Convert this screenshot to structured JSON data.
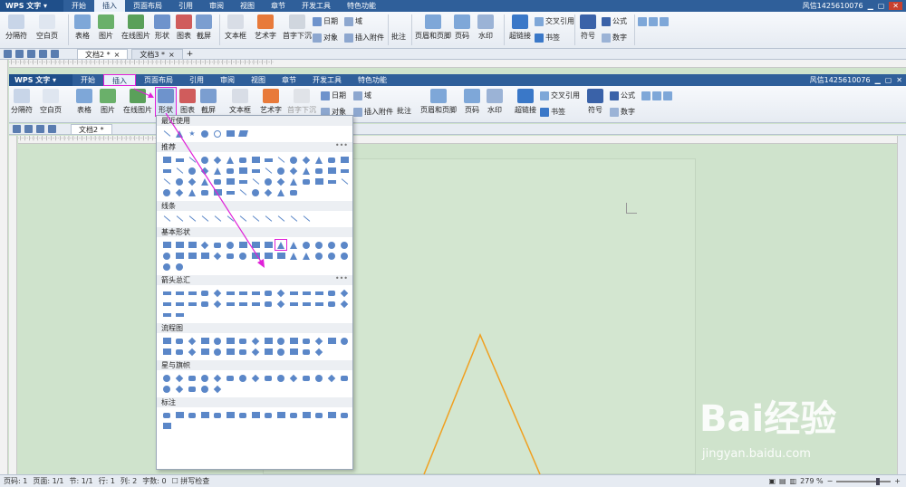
{
  "outer": {
    "app_title": "WPS 文字",
    "menus": [
      "开始",
      "插入",
      "页面布局",
      "引用",
      "审阅",
      "视图",
      "章节",
      "开发工具",
      "特色功能"
    ],
    "user": "风信1425610076",
    "doc_tabs": [
      "文档2 *",
      "文档3 *"
    ]
  },
  "inner": {
    "app_title": "WPS 文字",
    "menus": [
      "开始",
      "插入",
      "页面布局",
      "引用",
      "审阅",
      "视图",
      "章节",
      "开发工具",
      "特色功能"
    ],
    "user": "风信1425610076",
    "doc_tab": "文档2 *"
  },
  "ribbon_outer": {
    "items": [
      "分隔符",
      "空白页",
      "表格",
      "图片",
      "在线图片",
      "形状",
      "图表",
      "截屏",
      "文本框",
      "艺术字",
      "首字下沉",
      "日期",
      "域",
      "对象",
      "插入附件",
      "批注",
      "页眉和页脚",
      "页码",
      "水印",
      "超链接",
      "交叉引用",
      "书签",
      "符号",
      "公式",
      "数字"
    ]
  },
  "ribbon_inner": {
    "items": [
      "分隔符",
      "空白页",
      "表格",
      "图片",
      "在线图片",
      "形状",
      "图表",
      "截屏",
      "文本框",
      "艺术字",
      "首字下沉",
      "日期",
      "域",
      "对象",
      "插入附件",
      "批注",
      "页眉和页脚",
      "页码",
      "水印",
      "超链接",
      "交叉引用",
      "书签",
      "符号",
      "公式",
      "数字"
    ]
  },
  "shapes_menu": {
    "sections": [
      "最近使用",
      "推荐",
      "线条",
      "基本形状",
      "箭头总汇",
      "流程图",
      "星与旗帜",
      "标注"
    ],
    "more": "•••"
  },
  "status": {
    "left": [
      "页码: 1",
      "页面: 1/1",
      "节: 1/1",
      "行: 1",
      "列: 2",
      "字数: 0"
    ],
    "spellcheck": "拼写检查",
    "zoom": "279 %"
  },
  "watermark": {
    "main": "Bai经验",
    "sub": "jingyan.baidu.com"
  },
  "colors": {
    "accent": "#2f5f9a",
    "highlight": "#e020d8",
    "triangle": "#f0a020",
    "page_bg": "#cfe3cc"
  }
}
